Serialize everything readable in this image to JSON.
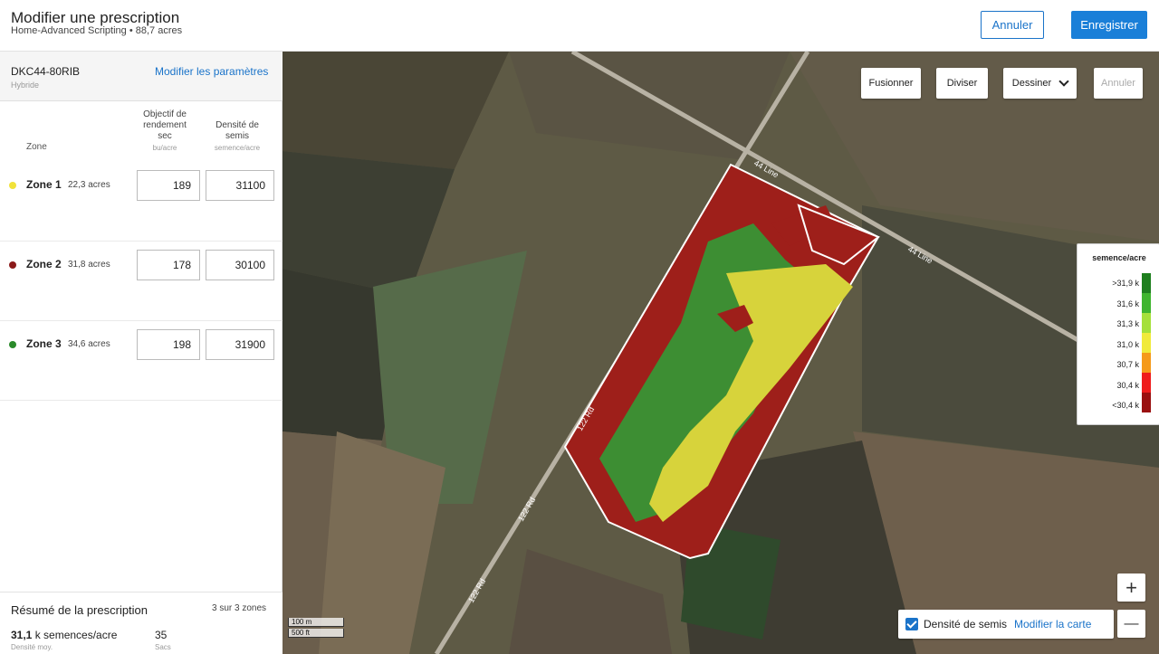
{
  "header": {
    "title": "Modifier une prescription",
    "subtitle": "Home-Advanced Scripting • 88,7 acres",
    "cancel_label": "Annuler",
    "save_label": "Enregistrer"
  },
  "hybrid": {
    "name": "DKC44-80RIB",
    "type": "Hybride",
    "edit_label": "Modifier les paramètres"
  },
  "table": {
    "zone_header": "Zone",
    "yield_header_1": "Objectif de",
    "yield_header_2": "rendement",
    "yield_header_3": "sec",
    "yield_unit": "bu/acre",
    "density_header_1": "Densité de",
    "density_header_2": "semis",
    "density_unit": "semence/acre"
  },
  "zones": [
    {
      "name": "Zone 1",
      "acres": "22,3 acres",
      "yield": "189",
      "density": "31100",
      "color": "#f1e23a"
    },
    {
      "name": "Zone 2",
      "acres": "31,8 acres",
      "yield": "178",
      "density": "30100",
      "color": "#8b1a1a"
    },
    {
      "name": "Zone 3",
      "acres": "34,6 acres",
      "yield": "198",
      "density": "31900",
      "color": "#2a8a2a"
    }
  ],
  "summary": {
    "title": "Résumé de la prescription",
    "count": "3 sur 3 zones",
    "density_value": "31,1",
    "density_unit": " k semences/acre",
    "density_label": "Densité moy.",
    "bags_value": "35",
    "bags_label": "Sacs"
  },
  "map": {
    "merge_label": "Fusionner",
    "split_label": "Diviser",
    "draw_label": "Dessiner",
    "undo_label": "Annuler",
    "legend": {
      "title": "semence/acre",
      "items": [
        {
          "label": ">31,9 k",
          "color": "#1e7f1e"
        },
        {
          "label": "31,6 k",
          "color": "#3fb52f"
        },
        {
          "label": "31,3 k",
          "color": "#a5e03a"
        },
        {
          "label": "31,0 k",
          "color": "#f0ea3a"
        },
        {
          "label": "30,7 k",
          "color": "#f59a1a"
        },
        {
          "label": "30,4 k",
          "color": "#ef1c1c"
        },
        {
          "label": "<30,4 k",
          "color": "#9a1010"
        }
      ]
    },
    "zoom_in": "+",
    "zoom_out": "—",
    "layer_label": "Densité de semis",
    "layer_link": "Modifier la carte",
    "scale_m": "100 m",
    "scale_ft": "500 ft",
    "road_labels": [
      "122 Rd",
      "122 Rd",
      "122 Rd",
      "44 Line",
      "44 Line"
    ]
  }
}
